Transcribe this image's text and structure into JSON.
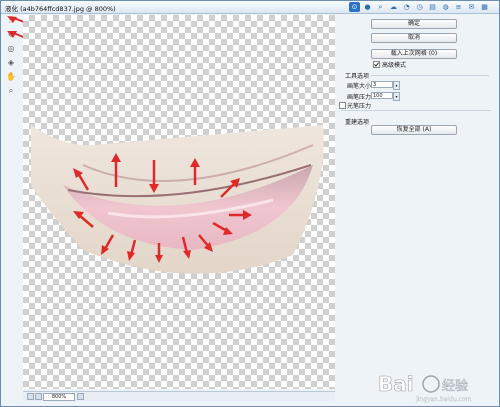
{
  "window": {
    "title": "液化 (a4b764ffcd837.jpg @ 800%)"
  },
  "panel_icons": [
    "zoom-icon",
    "user-icon",
    "search-icon",
    "cloud-icon",
    "gauge-icon",
    "clock-icon",
    "layers-icon",
    "globe-icon",
    "menu-icon",
    "chat-icon",
    "grid-icon"
  ],
  "left_tools": [
    "forward-warp-icon",
    "reconstruct-icon",
    "pucker-icon",
    "bloat-icon",
    "hand-icon",
    "zoom-icon"
  ],
  "right_panel": {
    "ok_label": "确定",
    "cancel_label": "取消",
    "load_last_mesh_label": "载入上次网格 (0)",
    "advanced_mode_label": "高级模式",
    "advanced_mode_checked": true,
    "tool_options_title": "工具选项",
    "brush_size_label": "画笔大小:",
    "brush_size_value": "3",
    "brush_pressure_label": "画笔压力:",
    "brush_pressure_value": "100",
    "stylus_pressure_label": "光笔压力",
    "stylus_pressure_checked": false,
    "reconstruct_title": "重建选项",
    "restore_all_label": "恢复全部 (A)"
  },
  "status": {
    "zoom_value": "800%"
  },
  "watermark": {
    "brand": "Bai",
    "brand2": "经验",
    "domain": "jingyan.baidu.com"
  },
  "colors": {
    "accent": "#2a73c9",
    "arrow": "#e02a2a",
    "lip": "#e8b8c3"
  }
}
